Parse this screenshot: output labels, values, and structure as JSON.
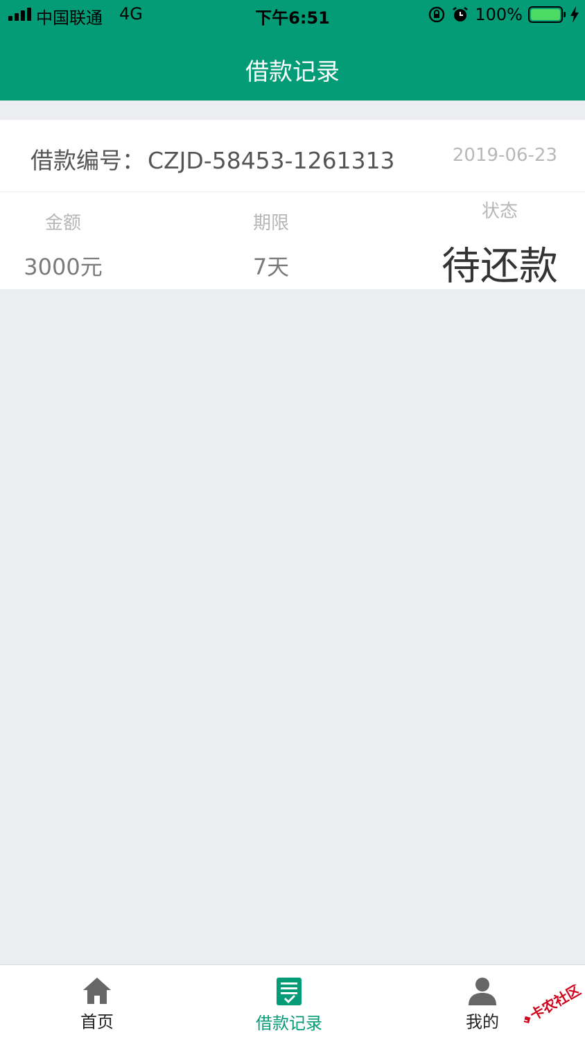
{
  "status_bar": {
    "carrier": "中国联通",
    "network": "4G",
    "time": "下午6:51",
    "battery": "100%"
  },
  "header": {
    "title": "借款记录",
    "background_color": "#049b77"
  },
  "record": {
    "loan_no_label": "借款编号：",
    "loan_no_value": "CZJD-58453-1261313",
    "date": "2019-06-23",
    "amount_label": "金额",
    "amount_value": "3000元",
    "term_label": "期限",
    "term_value": "7天",
    "status_label": "状态",
    "status_value": "待还款"
  },
  "tabs": [
    {
      "label": "首页",
      "icon": "home-icon",
      "active": false
    },
    {
      "label": "借款记录",
      "icon": "record-icon",
      "active": true
    },
    {
      "label": "我的",
      "icon": "person-icon",
      "active": false
    }
  ],
  "watermark": {
    "text": "卡农社区",
    "color": "#d0021b"
  }
}
